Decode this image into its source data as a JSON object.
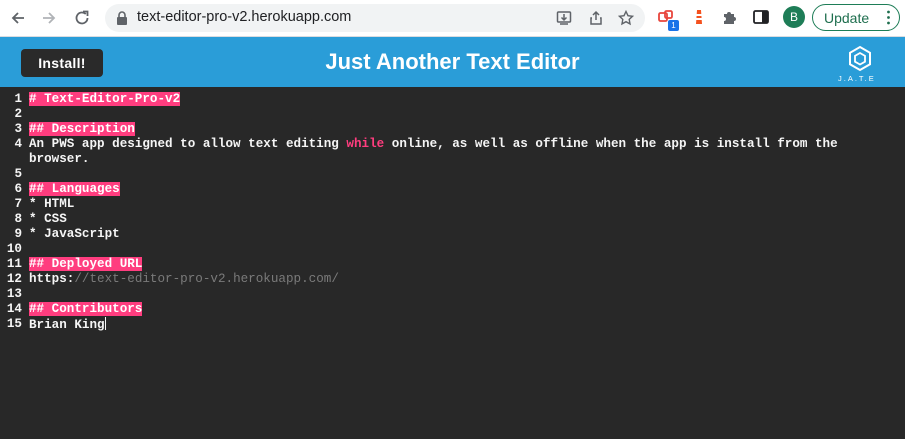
{
  "browser": {
    "url": "text-editor-pro-v2.herokuapp.com",
    "extension_badge": "1",
    "profile_initial": "B",
    "update_label": "Update"
  },
  "app": {
    "install_label": "Install!",
    "title": "Just Another Text Editor",
    "logo_text": "J.A.T.E"
  },
  "editor": {
    "lines": [
      {
        "num": "1",
        "text": "# Text-Editor-Pro-v2",
        "style": "heading"
      },
      {
        "num": "2",
        "text": "",
        "style": "plain"
      },
      {
        "num": "3",
        "text": "## Description",
        "style": "heading"
      },
      {
        "num": "4",
        "text": "An PWS app designed to allow text editing while online, as well as offline when the app is install from the",
        "style": "plain"
      },
      {
        "num": "",
        "text": "browser.",
        "style": "plain"
      },
      {
        "num": "5",
        "text": "",
        "style": "plain"
      },
      {
        "num": "6",
        "text": "## Languages",
        "style": "heading"
      },
      {
        "num": "7",
        "text": "* HTML",
        "style": "plain"
      },
      {
        "num": "8",
        "text": "* CSS",
        "style": "plain"
      },
      {
        "num": "9",
        "text": "* JavaScript",
        "style": "plain"
      },
      {
        "num": "10",
        "text": "",
        "style": "plain"
      },
      {
        "num": "11",
        "text": "## Deployed URL",
        "style": "heading"
      },
      {
        "num": "12",
        "text": "https://text-editor-pro-v2.herokuapp.com/",
        "style": "url"
      },
      {
        "num": "13",
        "text": "",
        "style": "plain"
      },
      {
        "num": "14",
        "text": "## Contributors",
        "style": "heading"
      },
      {
        "num": "15",
        "text": "Brian King",
        "style": "cursor"
      }
    ],
    "keyword": "while",
    "url_scheme": "https:",
    "accent_color": "#ff3d7f"
  },
  "colors": {
    "header_bg": "#2a9dd8",
    "editor_bg": "#282828"
  }
}
